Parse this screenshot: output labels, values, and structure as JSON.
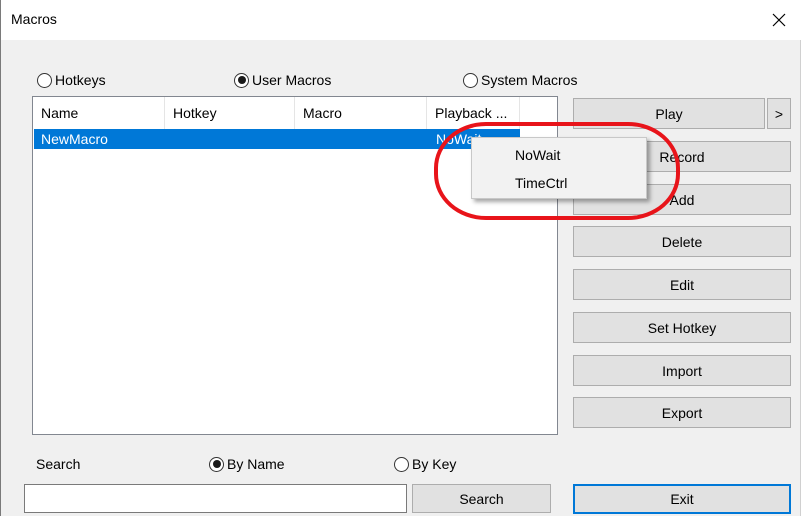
{
  "window": {
    "title": "Macros"
  },
  "icons": {
    "close": "close-icon"
  },
  "mode_options": [
    {
      "label": "Hotkeys",
      "selected": false
    },
    {
      "label": "User Macros",
      "selected": true
    },
    {
      "label": "System Macros",
      "selected": false
    }
  ],
  "table": {
    "columns": [
      "Name",
      "Hotkey",
      "Macro",
      "Playback ..."
    ],
    "rows": [
      {
        "name": "NewMacro",
        "hotkey": "",
        "macro": "",
        "playback": "NoWait",
        "selected": true
      }
    ]
  },
  "playback_menu": {
    "items": [
      "NoWait",
      "TimeCtrl"
    ]
  },
  "actions": {
    "play": "Play",
    "play_more": ">",
    "record": "Record",
    "add": "Add",
    "delete": "Delete",
    "edit": "Edit",
    "set_hotkey": "Set Hotkey",
    "import": "Import",
    "export": "Export",
    "exit": "Exit"
  },
  "search": {
    "label": "Search",
    "value": "",
    "button": "Search",
    "options": [
      {
        "label": "By Name",
        "selected": true
      },
      {
        "label": "By Key",
        "selected": false
      }
    ]
  },
  "colors": {
    "selection": "#0078d7",
    "highlight_ring": "#e8141a",
    "default_button_border": "#0078d7"
  }
}
